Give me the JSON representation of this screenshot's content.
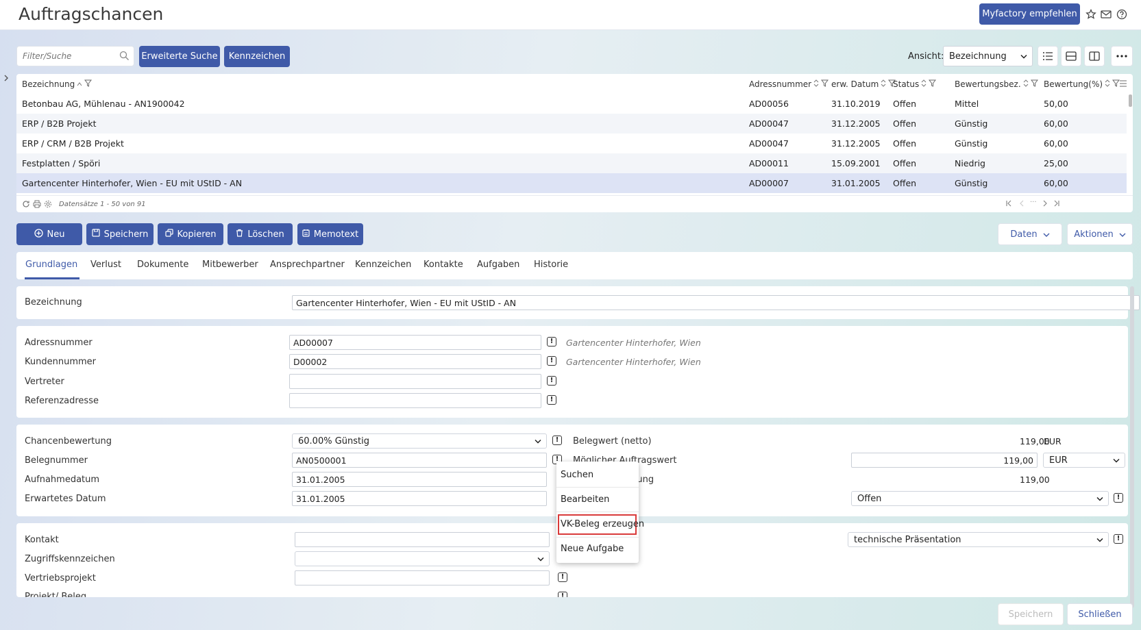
{
  "app": {
    "title": "Auftragschancen",
    "recommend_label": "Myfactory empfehlen",
    "accent_color": "#3f5aa8"
  },
  "toolbar": {
    "filter_placeholder": "Filter/Suche",
    "advanced_search_label": "Erweiterte Suche",
    "tags_label": "Kennzeichen",
    "view_label": "Ansicht:",
    "view_value": "Bezeichnung"
  },
  "grid": {
    "columns": [
      "Bezeichnung",
      "Adressnummer",
      "erw. Datum",
      "Status",
      "Bewertungsbez.",
      "Bewertung(%)"
    ],
    "rows": [
      [
        "Betonbau AG, Mühlenau - AN1900042",
        "AD00056",
        "31.10.2019",
        "Offen",
        "Mittel",
        "50,00"
      ],
      [
        "ERP / B2B Projekt",
        "AD00047",
        "31.12.2005",
        "Offen",
        "Günstig",
        "60,00"
      ],
      [
        "ERP / CRM / B2B Projekt",
        "AD00047",
        "31.12.2005",
        "Offen",
        "Günstig",
        "60,00"
      ],
      [
        "Festplatten / Spöri",
        "AD00011",
        "15.09.2001",
        "Offen",
        "Niedrig",
        "25,00"
      ],
      [
        "Gartencenter Hinterhofer, Wien - EU mit UStID - AN",
        "AD00007",
        "31.01.2005",
        "Offen",
        "Günstig",
        "60,00"
      ]
    ],
    "footer": "Datensätze 1 - 50 von 91",
    "pager_ellipsis": "···"
  },
  "actions": {
    "new": "Neu",
    "save": "Speichern",
    "copy": "Kopieren",
    "delete": "Löschen",
    "memo": "Memotext",
    "data": "Daten",
    "actions": "Aktionen"
  },
  "tabs": [
    "Grundlagen",
    "Verlust",
    "Dokumente",
    "Mitbewerber",
    "Ansprechpartner",
    "Kennzeichen",
    "Kontakte",
    "Aufgaben",
    "Historie"
  ],
  "form": {
    "bezeichnung_label": "Bezeichnung",
    "bezeichnung_value": "Gartencenter Hinterhofer, Wien - EU mit UStID - AN",
    "adressnummer_label": "Adressnummer",
    "adressnummer_value": "AD00007",
    "adressnummer_hint": "Gartencenter Hinterhofer, Wien",
    "kundennummer_label": "Kundennummer",
    "kundennummer_value": "D00002",
    "kundennummer_hint": "Gartencenter Hinterhofer, Wien",
    "vertreter_label": "Vertreter",
    "referenzadresse_label": "Referenzadresse",
    "chancenbewertung_label": "Chancenbewertung",
    "chancenbewertung_value": "60.00% Günstig",
    "belegnummer_label": "Belegnummer",
    "belegnummer_value": "AN0500001",
    "aufnahmedatum_label": "Aufnahmedatum",
    "aufnahmedatum_value": "31.01.2005",
    "erwartetes_datum_label": "Erwartetes Datum",
    "erwartetes_datum_value": "31.01.2005",
    "belegwert_label": "Belegwert (netto)",
    "belegwert_value": "119,00",
    "belegwert_currency": "EUR",
    "moeglicher_label_partial": "Möglicher Auftragswert",
    "moeglicher_value": "119,00",
    "moeglicher_currency": "EUR",
    "bewertung_label_partial": "rung",
    "bewertung_value": "119,00",
    "status_value": "Offen",
    "kontakt_label": "Kontakt",
    "zugriffskennzeichen_label": "Zugriffskennzeichen",
    "vertriebsprojekt_label": "Vertriebsprojekt",
    "cutoff_label": "Projekt/ Beleg",
    "phase_value": "technische Präsentation"
  },
  "context_menu": {
    "items": [
      "Suchen",
      "Bearbeiten",
      "VK-Beleg erzeugen",
      "Neue Aufgabe"
    ]
  },
  "footer": {
    "save": "Speichern",
    "close": "Schließen"
  }
}
